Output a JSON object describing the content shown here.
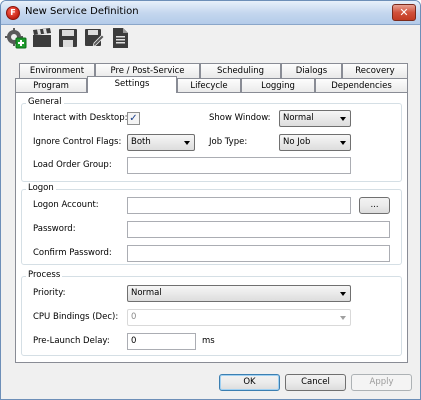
{
  "window": {
    "title": "New Service Definition",
    "app_icon_letter": "F",
    "close_symbol": "✕"
  },
  "toolbar": {
    "buttons": [
      "add-service-icon",
      "clapperboard-icon",
      "save-icon",
      "save-edit-icon",
      "document-icon"
    ]
  },
  "tabs": {
    "row1": [
      "Environment",
      "Pre / Post-Service",
      "Scheduling",
      "Dialogs",
      "Recovery"
    ],
    "row2": [
      "Program",
      "Settings",
      "Lifecycle",
      "Logging",
      "Dependencies"
    ],
    "active": "Settings"
  },
  "general": {
    "legend": "General",
    "interact_label": "Interact with Desktop:",
    "interact_checked": "✓",
    "show_window_label": "Show Window:",
    "show_window_value": "Normal",
    "ignore_flags_label": "Ignore Control Flags:",
    "ignore_flags_value": "Both",
    "job_type_label": "Job Type:",
    "job_type_value": "No Job",
    "load_order_label": "Load Order Group:",
    "load_order_value": ""
  },
  "logon": {
    "legend": "Logon",
    "account_label": "Logon Account:",
    "account_value": "",
    "browse_label": "...",
    "password_label": "Password:",
    "password_value": "",
    "confirm_label": "Confirm Password:",
    "confirm_value": ""
  },
  "process": {
    "legend": "Process",
    "priority_label": "Priority:",
    "priority_value": "Normal",
    "cpu_label": "CPU Bindings (Dec):",
    "cpu_value": "0",
    "delay_label": "Pre-Launch Delay:",
    "delay_value": "0",
    "delay_unit": "ms"
  },
  "footer": {
    "ok": "OK",
    "cancel": "Cancel",
    "apply": "Apply"
  }
}
